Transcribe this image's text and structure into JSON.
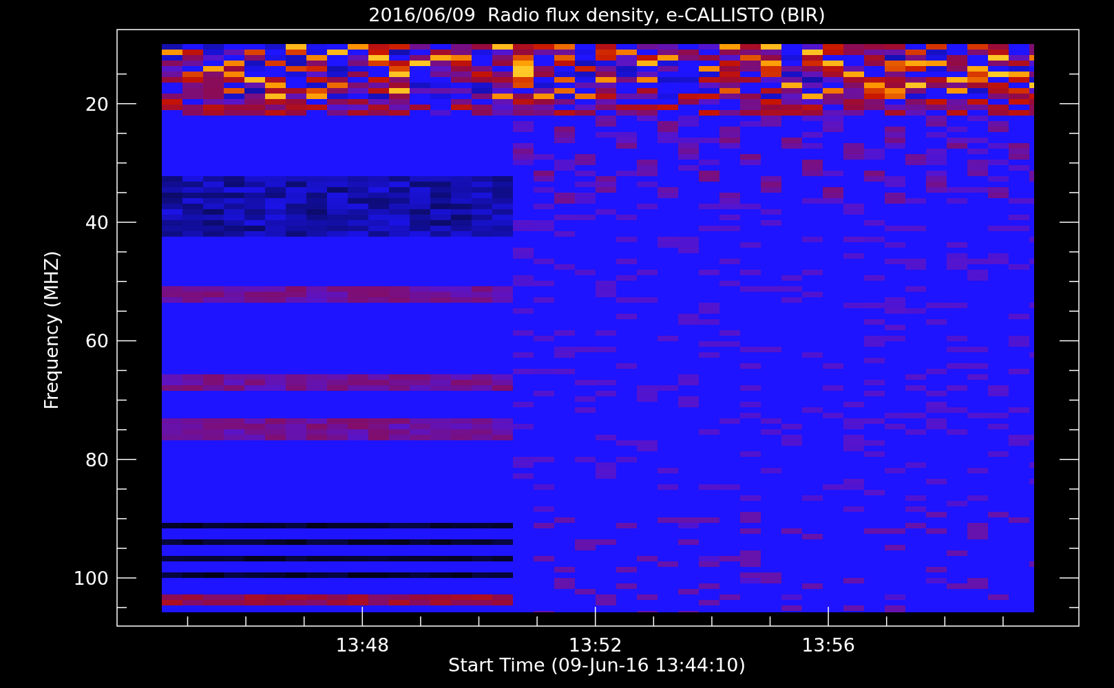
{
  "title": "2016/06/09  Radio flux density, e-CALLISTO (BIR)",
  "y_axis": {
    "label": "Frequency (MHZ)",
    "tick_labels": [
      "20",
      "40",
      "60",
      "80",
      "100"
    ]
  },
  "x_axis": {
    "label": "Start Time (09-Jun-16 13:44:10)",
    "tick_labels": [
      "13:48",
      "13:52",
      "13:56"
    ]
  }
}
